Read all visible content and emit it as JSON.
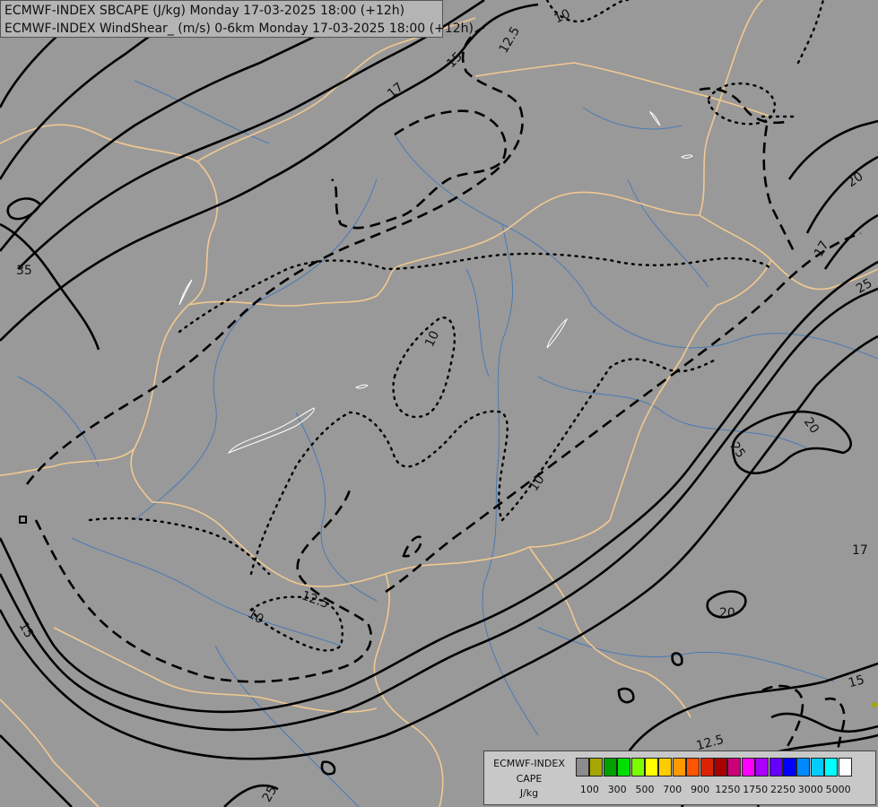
{
  "title": {
    "line1": "ECMWF-INDEX SBCAPE (J/kg) Monday 17-03-2025 18:00 (+12h)",
    "line2": "ECMWF-INDEX WindShear_ (m/s) 0-6km Monday 17-03-2025 18:00 (+12h)"
  },
  "legend": {
    "line1": "ECMWF-INDEX",
    "line2": "CAPE",
    "line3": "J/kg",
    "colors": [
      "#8c8c8c",
      "#a6a600",
      "#00a000",
      "#00e000",
      "#7cff00",
      "#ffff00",
      "#ffcc00",
      "#ff9900",
      "#ff5500",
      "#dd2200",
      "#aa0000",
      "#cc0077",
      "#ff00ff",
      "#aa00ff",
      "#6600ff",
      "#0000ff",
      "#0088ff",
      "#00ccff",
      "#00ffff",
      "#ffffff"
    ],
    "ticks": [
      "100",
      "300",
      "500",
      "700",
      "900",
      "1250",
      "1750",
      "2250",
      "3000",
      "5000"
    ]
  },
  "contour_labels": [
    "10",
    "12.5",
    "15",
    "17",
    "35",
    "20",
    "25",
    "10",
    "10",
    "10",
    "12.5",
    "20",
    "17",
    "15",
    "12.5",
    "15",
    "25"
  ],
  "colors": {
    "background": "#999999",
    "border": "#f2c890",
    "river": "#4a7ab5",
    "contour": "#000000"
  }
}
